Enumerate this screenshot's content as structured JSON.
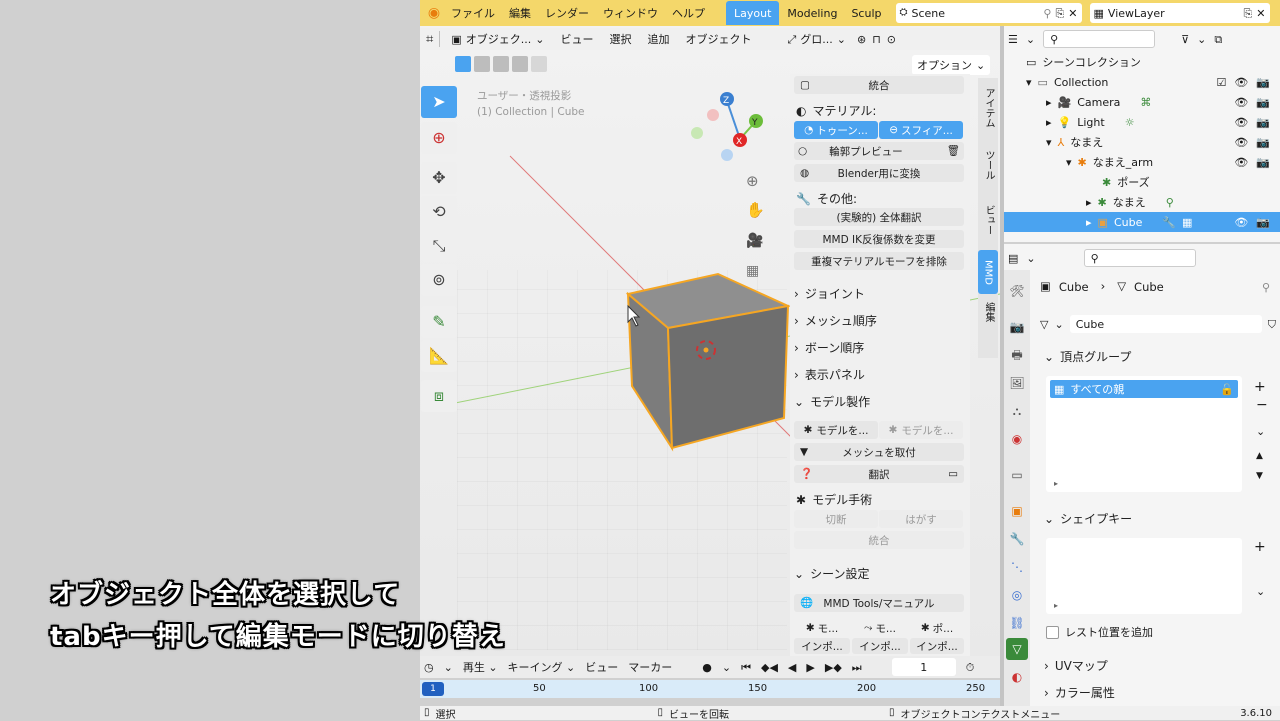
{
  "menu": {
    "items": [
      "ファイル",
      "編集",
      "レンダー",
      "ウィンドウ",
      "ヘルプ"
    ],
    "workspaces": [
      "Layout",
      "Modeling",
      "Sculp"
    ],
    "scene": "Scene",
    "view_layer": "ViewLayer"
  },
  "viewport_header": {
    "mode": "オブジェク...",
    "menus": [
      "ビュー",
      "選択",
      "追加",
      "オブジェクト"
    ],
    "transform": "グロ...",
    "options": "オプション"
  },
  "viewport": {
    "view_name": "ユーザー・透視投影",
    "collection_path": "(1) Collection | Cube"
  },
  "mmd_panel": {
    "join": "統合",
    "material_label": "マテリアル:",
    "toon": "トゥーン...",
    "sphere": "スフィア...",
    "edge_preview": "輪郭プレビュー",
    "convert_blender": "Blender用に変換",
    "other_label": "その他:",
    "translate_all": "(実験的) 全体翻訳",
    "ik_loop": "MMD IK反復係数を変更",
    "remove_dup_mat": "重複マテリアルモーフを排除",
    "sections": [
      "ジョイント",
      "メッシュ順序",
      "ボーン順序",
      "表示パネル"
    ],
    "model_production": "モデル製作",
    "model_create": "モデルを...",
    "model_create2": "モデルを...",
    "attach_mesh": "メッシュを取付",
    "translate": "翻訳",
    "model_surgery": "モデル手術",
    "cut": "切断",
    "peel": "はがす",
    "join2": "統合",
    "scene_settings": "シーン設定",
    "manual": "MMD Tools/マニュアル",
    "mo1": "モ...",
    "mo2": "モ...",
    "mo3": "ポ...",
    "import1": "インポ...",
    "import2": "インポ...",
    "import3": "インポ..."
  },
  "side_tabs": [
    "アイテム",
    "ツール",
    "ビュー",
    "MMD",
    "編集"
  ],
  "outliner": {
    "scene_collection": "シーンコレクション",
    "rows": [
      {
        "label": "Collection",
        "indent": 0
      },
      {
        "label": "Camera",
        "indent": 1
      },
      {
        "label": "Light",
        "indent": 1
      },
      {
        "label": "なまえ",
        "indent": 1
      },
      {
        "label": "なまえ_arm",
        "indent": 2
      },
      {
        "label": "ポーズ",
        "indent": 3
      },
      {
        "label": "なまえ",
        "indent": 3
      },
      {
        "label": "Cube",
        "indent": 3
      }
    ]
  },
  "properties": {
    "breadcrumb_object": "Cube",
    "breadcrumb_data": "Cube",
    "mesh_name": "Cube",
    "vertex_groups": "頂点グループ",
    "vertex_group_item": "すべての親",
    "shape_keys": "シェイプキー",
    "relative_to_rest": "レスト位置を追加",
    "uv_maps": "UVマップ",
    "color_attributes": "カラー属性"
  },
  "timeline": {
    "playback": "再生",
    "keying": "キーイング",
    "view": "ビュー",
    "marker": "マーカー",
    "current_frame": "1",
    "ticks": [
      "50",
      "100",
      "150",
      "200",
      "250"
    ],
    "start_marker": "1"
  },
  "status": {
    "select": "選択",
    "rotate_view": "ビューを回転",
    "context_menu": "オブジェクトコンテクストメニュー",
    "version": "3.6.10"
  },
  "subtitle": {
    "line1": "オブジェクト全体を選択して",
    "line2": "tabキー押して編集モードに切り替え"
  },
  "colors": {
    "accent": "#4aa3f0",
    "selection_orange": "#f5a623",
    "header_bg": "#e2e2e2",
    "panel_bg": "#f0f0f0"
  }
}
